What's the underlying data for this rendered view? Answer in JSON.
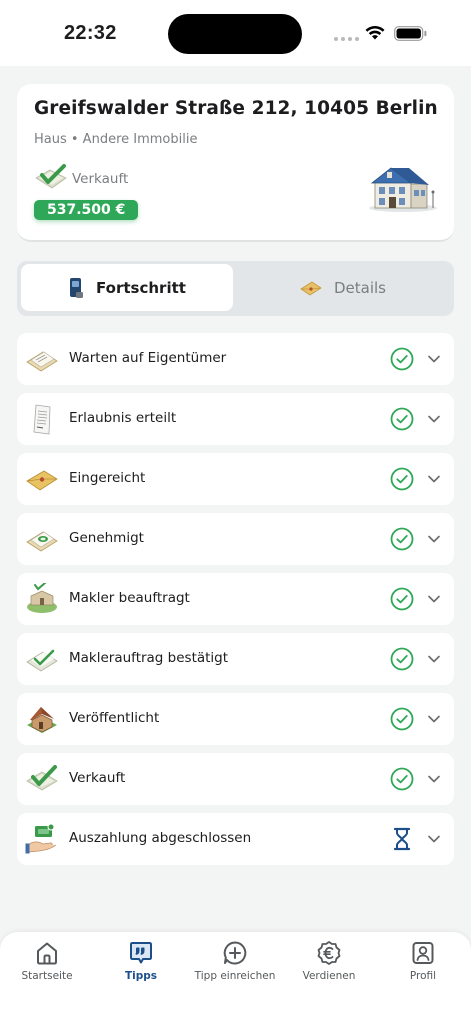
{
  "status_bar": {
    "time": "22:32"
  },
  "property": {
    "address": "Greifswalder Straße 212, 10405 Berlin",
    "type": "Haus • Andere Immobilie",
    "status": "Verkauft",
    "price": "537.500 €",
    "icon": "house-icon"
  },
  "segments": [
    {
      "label": "Fortschritt",
      "icon": "phone-icon",
      "active": true
    },
    {
      "label": "Details",
      "icon": "envelope-icon",
      "active": false
    }
  ],
  "steps": [
    {
      "label": "Warten auf Eigentümer",
      "icon": "document-envelope-icon",
      "state": "done"
    },
    {
      "label": "Erlaubnis erteilt",
      "icon": "paper-icon",
      "state": "done"
    },
    {
      "label": "Eingereicht",
      "icon": "envelope-icon",
      "state": "done"
    },
    {
      "label": "Genehmigt",
      "icon": "approved-envelope-icon",
      "state": "done"
    },
    {
      "label": "Makler beauftragt",
      "icon": "broker-icon",
      "state": "done"
    },
    {
      "label": "Maklerauftrag bestätigt",
      "icon": "confirmed-document-icon",
      "state": "done"
    },
    {
      "label": "Veröffentlicht",
      "icon": "house-icon",
      "state": "done"
    },
    {
      "label": "Verkauft",
      "icon": "sold-check-icon",
      "state": "done"
    },
    {
      "label": "Auszahlung abgeschlossen",
      "icon": "payout-icon",
      "state": "pending"
    }
  ],
  "tab_bar": [
    {
      "label": "Startseite",
      "icon": "home-icon",
      "active": false
    },
    {
      "label": "Tipps",
      "icon": "tips-icon",
      "active": true
    },
    {
      "label": "Tipp einreichen",
      "icon": "plus-circle-icon",
      "active": false
    },
    {
      "label": "Verdienen",
      "icon": "euro-icon",
      "active": false
    },
    {
      "label": "Profil",
      "icon": "profile-icon",
      "active": false
    }
  ],
  "colors": {
    "accent": "#1c4f8a",
    "success": "#2ea758",
    "pending": "#1c4f8a",
    "background": "#f3f4f4"
  }
}
